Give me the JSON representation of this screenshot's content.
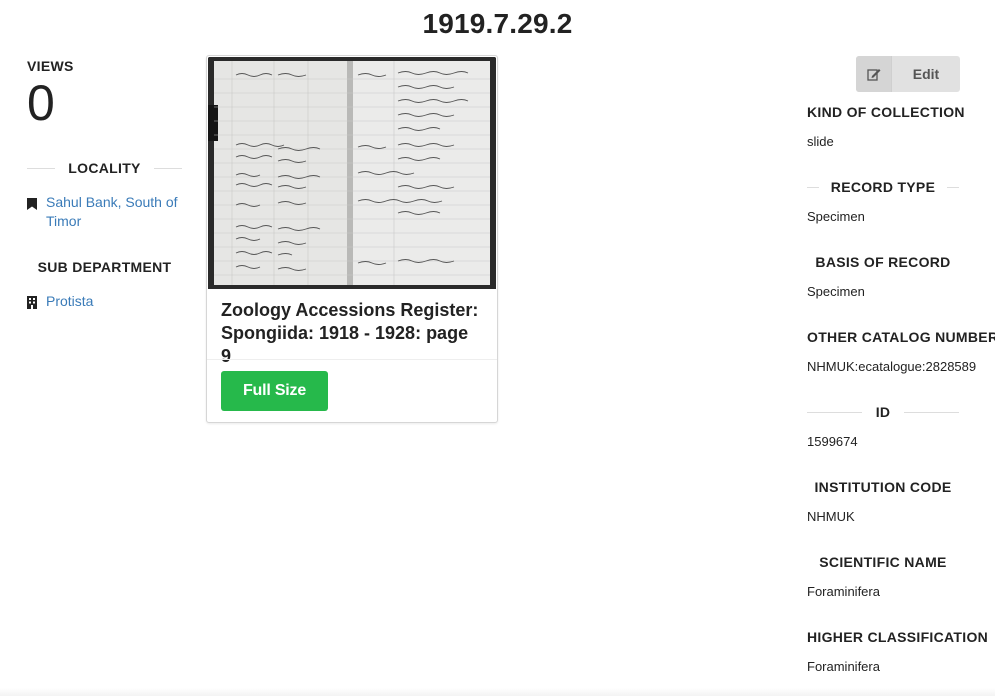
{
  "page": {
    "title": "1919.7.29.2"
  },
  "stats": {
    "views_label": "VIEWS",
    "views_count": "0"
  },
  "locality": {
    "heading": "LOCALITY",
    "link_text": "Sahul Bank, South of Timor",
    "icon": "bookmark-icon"
  },
  "sub_department": {
    "heading": "SUB DEPARTMENT",
    "link_text": "Protista",
    "icon": "building-icon"
  },
  "card": {
    "title": "Zoology Accessions Register: Spongiida: 1918 - 1928: page 9",
    "button_label": "Full Size",
    "button_color": "#26b94b"
  },
  "edit": {
    "label": "Edit",
    "icon": "edit-icon"
  },
  "fields": [
    {
      "heading": "KIND OF COLLECTION",
      "value": "slide"
    },
    {
      "heading": "RECORD TYPE",
      "value": "Specimen"
    },
    {
      "heading": "BASIS OF RECORD",
      "value": "Specimen"
    },
    {
      "heading": "OTHER CATALOG NUMBERS",
      "value": "NHMUK:ecatalogue:2828589"
    },
    {
      "heading": "ID",
      "value": "1599674"
    },
    {
      "heading": "INSTITUTION CODE",
      "value": "NHMUK"
    },
    {
      "heading": "SCIENTIFIC NAME",
      "value": "Foraminifera"
    },
    {
      "heading": "HIGHER CLASSIFICATION",
      "value": "Foraminifera"
    }
  ],
  "colors": {
    "link": "#3a7bb8",
    "accent_green": "#26b94b",
    "text": "#222222"
  }
}
